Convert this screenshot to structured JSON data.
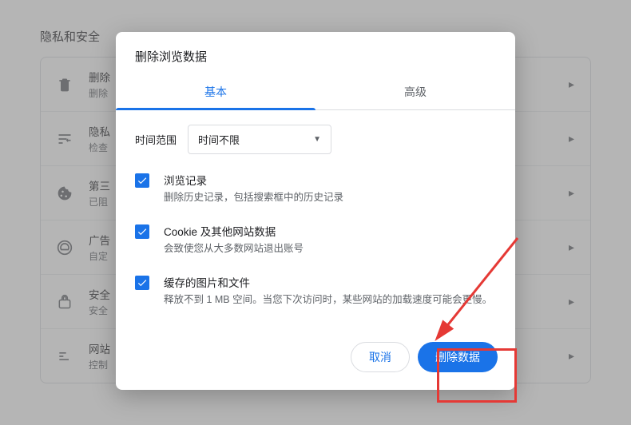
{
  "section": {
    "title": "隐私和安全"
  },
  "rows": [
    {
      "title": "删除",
      "desc": "删除"
    },
    {
      "title": "隐私",
      "desc": "检查"
    },
    {
      "title": "第三",
      "desc": "已阻"
    },
    {
      "title": "广告",
      "desc": "自定"
    },
    {
      "title": "安全",
      "desc": "安全"
    },
    {
      "title": "网站",
      "desc": "控制"
    }
  ],
  "dialog": {
    "title": "删除浏览数据",
    "tabs": {
      "basic": "基本",
      "advanced": "高级"
    },
    "time_label": "时间范围",
    "time_value": "时间不限",
    "items": [
      {
        "title": "浏览记录",
        "desc": "删除历史记录，包括搜索框中的历史记录"
      },
      {
        "title": "Cookie 及其他网站数据",
        "desc": "会致使您从大多数网站退出账号"
      },
      {
        "title": "缓存的图片和文件",
        "desc": "释放不到 1 MB 空间。当您下次访问时，某些网站的加载速度可能会更慢。"
      }
    ],
    "cancel": "取消",
    "confirm": "删除数据"
  }
}
